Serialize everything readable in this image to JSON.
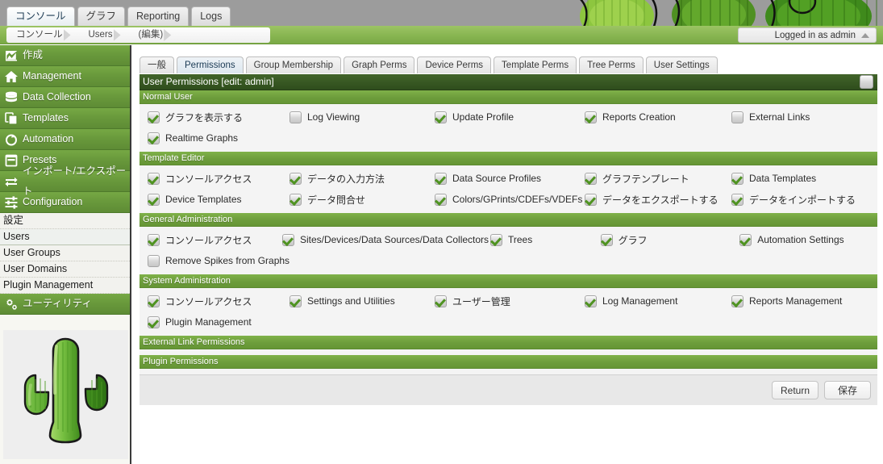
{
  "header": {
    "main_tabs": [
      {
        "label": "コンソール",
        "active": true
      },
      {
        "label": "グラフ",
        "active": false
      },
      {
        "label": "Reporting",
        "active": false
      },
      {
        "label": "Logs",
        "active": false
      }
    ],
    "breadcrumbs": [
      "コンソール",
      "Users",
      "(編集)"
    ],
    "login_label": "Logged in as admin"
  },
  "sidebar": {
    "groups": [
      {
        "label": "作成",
        "icon": "chart-icon"
      },
      {
        "label": "Management",
        "icon": "home-icon"
      },
      {
        "label": "Data Collection",
        "icon": "database-icon"
      },
      {
        "label": "Templates",
        "icon": "copy-icon"
      },
      {
        "label": "Automation",
        "icon": "circle-arrow-icon"
      },
      {
        "label": "Presets",
        "icon": "window-icon"
      },
      {
        "label": "インポート/エクスポート",
        "icon": "exchange-icon"
      },
      {
        "label": "Configuration",
        "icon": "sliders-icon"
      }
    ],
    "config_items": [
      {
        "label": "設定",
        "selected": false
      },
      {
        "label": "Users",
        "selected": true
      },
      {
        "label": "User Groups",
        "selected": false
      },
      {
        "label": "User Domains",
        "selected": false
      },
      {
        "label": "Plugin Management",
        "selected": false
      }
    ],
    "utility": {
      "label": "ユーティリティ",
      "icon": "gears-icon"
    },
    "logo_alt": "cactus-logo"
  },
  "content": {
    "sub_tabs": [
      {
        "label": "一般",
        "active": false
      },
      {
        "label": "Permissions",
        "active": true
      },
      {
        "label": "Group Membership",
        "active": false
      },
      {
        "label": "Graph Perms",
        "active": false
      },
      {
        "label": "Device Perms",
        "active": false
      },
      {
        "label": "Template Perms",
        "active": false
      },
      {
        "label": "Tree Perms",
        "active": false
      },
      {
        "label": "User Settings",
        "active": false
      }
    ],
    "panel_title": "User Permissions [edit: admin]",
    "select_all_checked": false,
    "sections": [
      {
        "title": "Normal User",
        "rows": [
          [
            {
              "label": "グラフを表示する",
              "checked": true
            },
            {
              "label": "Log Viewing",
              "checked": false
            },
            {
              "label": "Update Profile",
              "checked": true
            },
            {
              "label": "Reports Creation",
              "checked": true
            },
            {
              "label": "External Links",
              "checked": false
            }
          ],
          [
            {
              "label": "Realtime Graphs",
              "checked": true
            }
          ]
        ]
      },
      {
        "title": "Template Editor",
        "rows": [
          [
            {
              "label": "コンソールアクセス",
              "checked": true
            },
            {
              "label": "データの入力方法",
              "checked": true
            },
            {
              "label": "Data Source Profiles",
              "checked": true
            },
            {
              "label": "グラフテンプレート",
              "checked": true
            },
            {
              "label": "Data Templates",
              "checked": true
            }
          ],
          [
            {
              "label": "Device Templates",
              "checked": true
            },
            {
              "label": "データ問合せ",
              "checked": true
            },
            {
              "label": "Colors/GPrints/CDEFs/VDEFs",
              "checked": true
            },
            {
              "label": "データをエクスポートする",
              "checked": true
            },
            {
              "label": "データをインポートする",
              "checked": true
            }
          ]
        ]
      },
      {
        "title": "General Administration",
        "rows": [
          [
            {
              "label": "コンソールアクセス",
              "checked": true
            },
            {
              "label": "Sites/Devices/Data Sources/Data Collectors",
              "checked": true
            },
            {
              "label": "Trees",
              "checked": true
            },
            {
              "label": "グラフ",
              "checked": true
            },
            {
              "label": "Automation Settings",
              "checked": true
            }
          ],
          [
            {
              "label": "Remove Spikes from Graphs",
              "checked": false
            }
          ]
        ]
      },
      {
        "title": "System Administration",
        "rows": [
          [
            {
              "label": "コンソールアクセス",
              "checked": true
            },
            {
              "label": "Settings and Utilities",
              "checked": true
            },
            {
              "label": "ユーザー管理",
              "checked": true
            },
            {
              "label": "Log Management",
              "checked": true
            },
            {
              "label": "Reports Management",
              "checked": true
            }
          ],
          [
            {
              "label": "Plugin Management",
              "checked": true
            }
          ]
        ]
      },
      {
        "title": "External Link Permissions",
        "rows": []
      },
      {
        "title": "Plugin Permissions",
        "rows": []
      }
    ],
    "footer": {
      "return_label": "Return",
      "save_label": "保存"
    }
  },
  "colors": {
    "brand_green": "#6d9d3c",
    "dark_green": "#2f4d1c",
    "banner_gray": "#9c9c9c",
    "check_green": "#4f9321"
  }
}
